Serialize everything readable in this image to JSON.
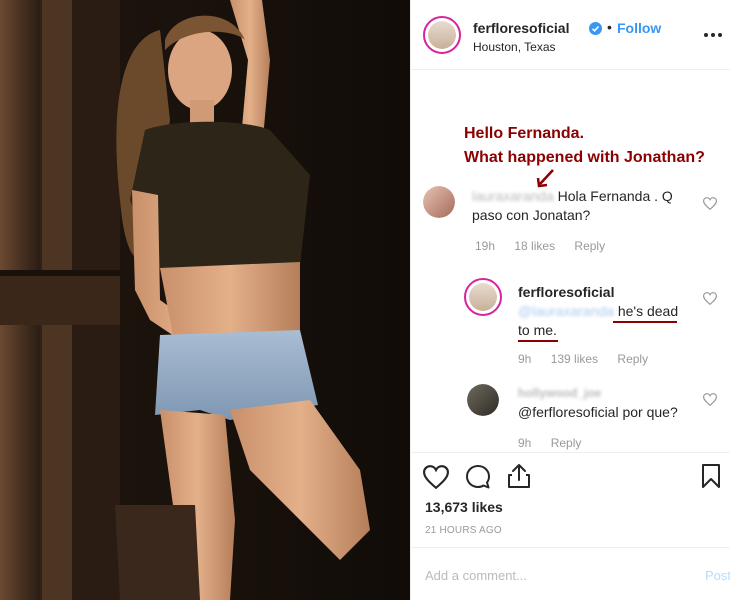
{
  "header": {
    "username": "ferfloresoficial",
    "follow": "Follow",
    "location": "Houston, Texas",
    "more": "•••"
  },
  "annotation": {
    "line1": "Hello Fernanda.",
    "line2": "What happened with Jonathan?"
  },
  "comments": [
    {
      "user": "lauraxaranda",
      "text1": "Hola Fernanda . Q",
      "text2": "paso con Jonatan?",
      "time": "19h",
      "likes": "18 likes",
      "reply": "Reply"
    },
    {
      "user": "ferfloresoficial",
      "mention": "@lauraxaranda",
      "text1": "he's dead",
      "text2": "to me.",
      "time": "9h",
      "likes": "139 likes",
      "reply": "Reply"
    },
    {
      "user": "hollywood_joe",
      "text1": "@ferfloresoficial por que?",
      "time": "9h",
      "reply": "Reply"
    }
  ],
  "likes_count": "13,673 likes",
  "timestamp": "21 HOURS AGO",
  "add_comment": {
    "placeholder": "Add a comment...",
    "post": "Post"
  },
  "colors": {
    "link": "#3897f0",
    "annotation": "#8b0000",
    "muted": "#999999"
  }
}
